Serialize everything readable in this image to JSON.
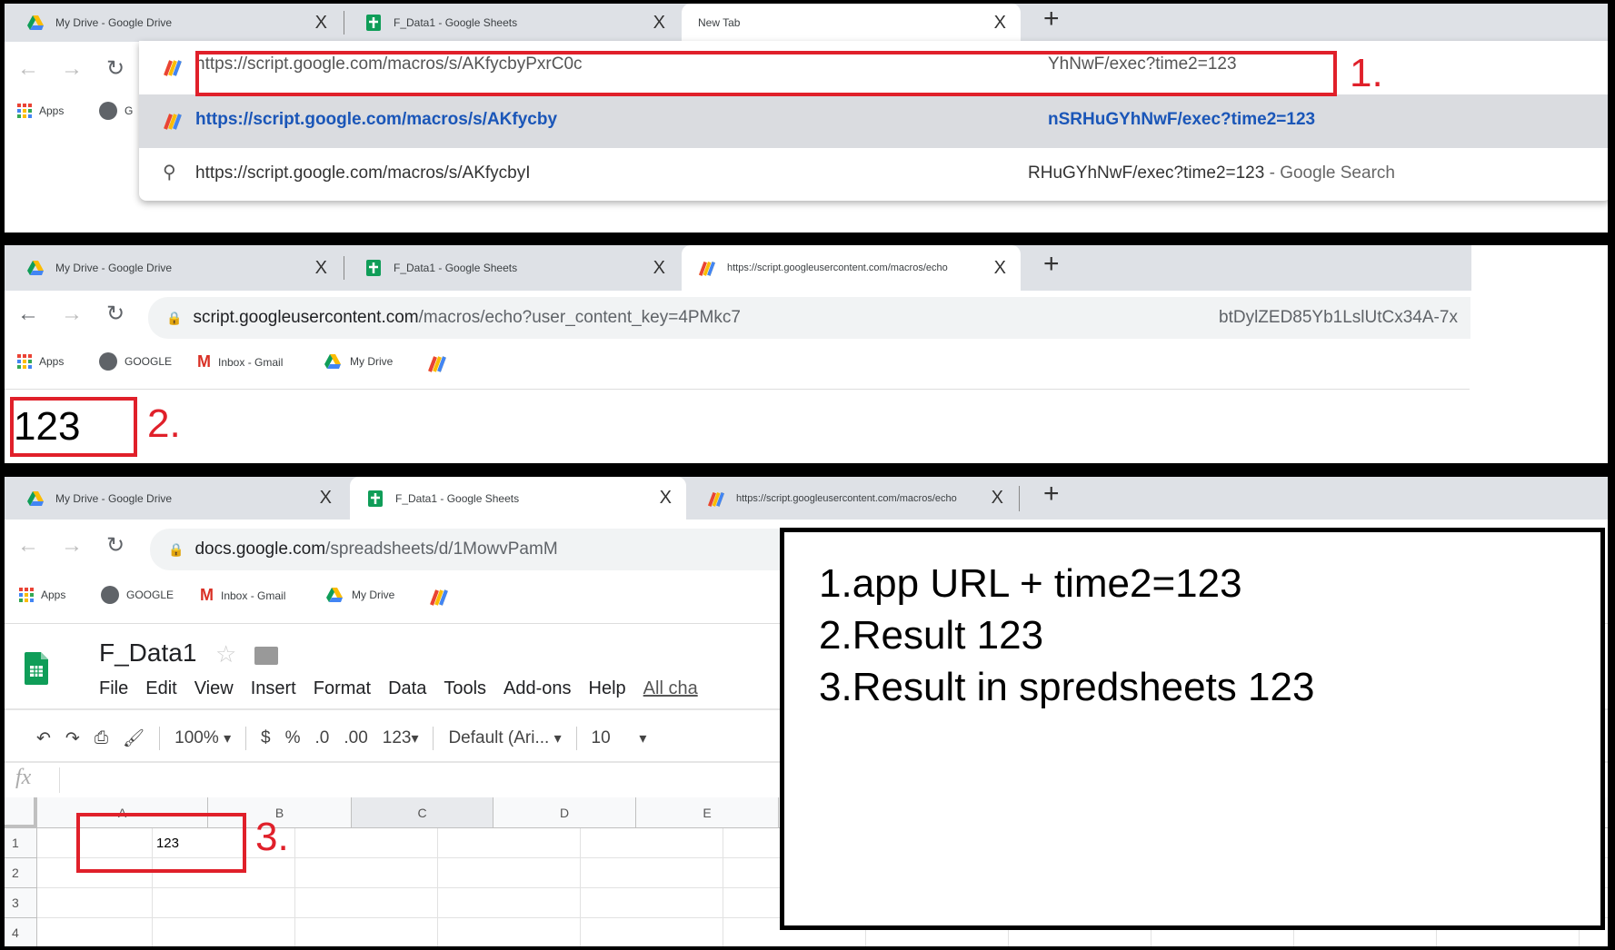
{
  "tabs": {
    "drive": "My Drive - Google Drive",
    "sheets": "F_Data1 - Google Sheets",
    "new_tab": "New Tab",
    "script": "https://script.googleusercontent.com/macros/echo",
    "close": "X",
    "plus": "+"
  },
  "panel1": {
    "omnibox_value_start": "https://script.google.com/macros/s/AKfycbyPxrC0c",
    "omnibox_value_end": "YhNwF/exec?time2=123",
    "suggestion1_start": "https://script.google.com/macros/s/AKfycby",
    "suggestion1_end": "nSRHuGYhNwF/exec?time2=123",
    "suggestion2_start": "https://script.google.com/macros/s/AKfycbyI",
    "suggestion2_end": "RHuGYhNwF/exec?time2=123",
    "suggestion2_suffix": " - Google Search",
    "bookmark_apps": "Apps",
    "bookmark_google_partial": "G",
    "annotation": "1."
  },
  "panel2": {
    "url_host": "script.googleusercontent.com",
    "url_path": "/macros/echo?user_content_key=4PMkc7",
    "url_end": "btDylZED85Yb1LslUtCx34A-7x",
    "page_output": "123",
    "annotation": "2."
  },
  "bookmarks": {
    "apps": "Apps",
    "google": "GOOGLE",
    "gmail": "Inbox - Gmail",
    "drive": "My Drive"
  },
  "panel3": {
    "url_host": "docs.google.com",
    "url_path": "/spreadsheets/d/1MowvPamM",
    "doc_title": "F_Data1",
    "menu": [
      "File",
      "Edit",
      "View",
      "Insert",
      "Format",
      "Data",
      "Tools",
      "Add-ons",
      "Help"
    ],
    "all_changes": "All cha",
    "toolbar": {
      "zoom": "100%",
      "currency": "$",
      "percent": "%",
      "dec_less": ".0",
      "dec_more": ".00",
      "format": "123",
      "font": "Default (Ari...",
      "size": "10"
    },
    "fx": "fx",
    "columns": [
      "A",
      "B",
      "C",
      "D",
      "E"
    ],
    "rows": [
      "1",
      "2",
      "3",
      "4"
    ],
    "cell_a1": "123",
    "annotation": "3."
  },
  "notes": [
    "1.app URL + time2=123",
    "2.Result 123",
    "3.Result in spredsheets 123"
  ],
  "colors": {
    "annotation_red": "#e0202a",
    "tab_strip": "#dee1e6",
    "suggest_blue": "#1a56b8",
    "sheets_green": "#0f9d58"
  }
}
